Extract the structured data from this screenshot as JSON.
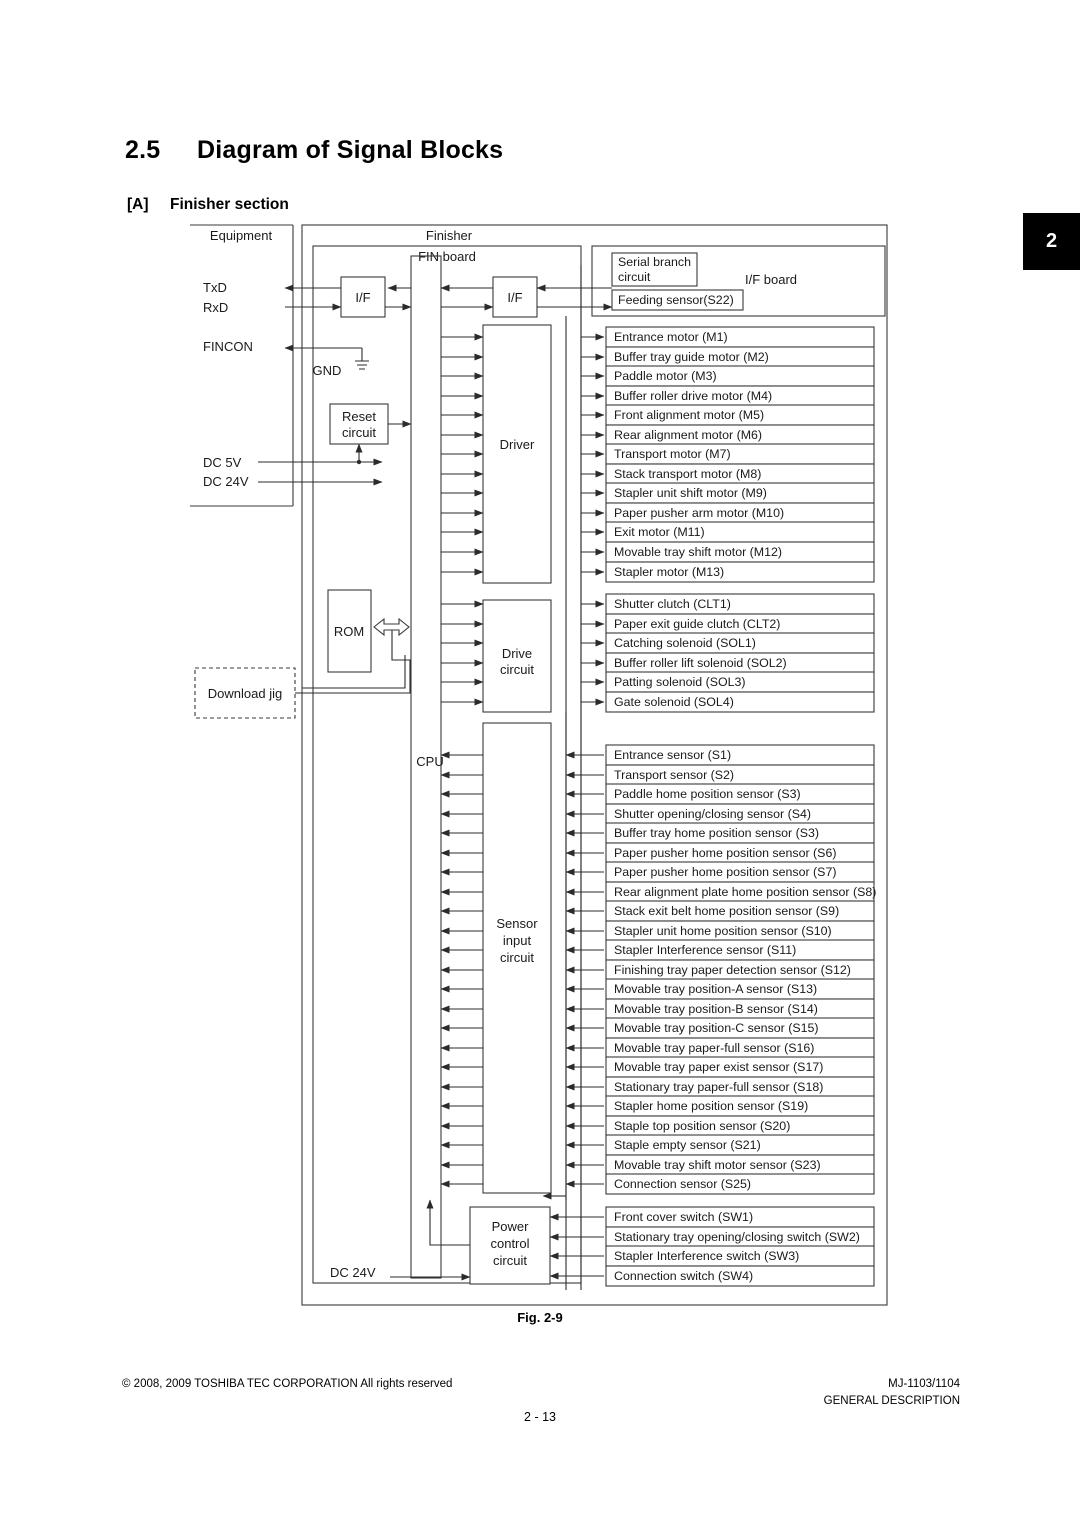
{
  "page": {
    "section_number": "2.5",
    "section_title": "Diagram of Signal Blocks",
    "subsection_tag": "[A]",
    "subsection_title": "Finisher section",
    "chapter_tab": "2",
    "figure_caption": "Fig. 2-9",
    "page_number": "2 - 13"
  },
  "footer": {
    "copyright": "© 2008, 2009 TOSHIBA TEC CORPORATION All rights reserved",
    "model": "MJ-1103/1104",
    "manual_section": "GENERAL DESCRIPTION"
  },
  "diagram": {
    "frames": {
      "equipment": "Equipment",
      "finisher": "Finisher",
      "fin_board": "FIN board",
      "if_board": "I/F board"
    },
    "signals": {
      "txd": "TxD",
      "rxd": "RxD",
      "fincon": "FINCON",
      "gnd": "GND",
      "dc5v": "DC 5V",
      "dc24v": "DC 24V",
      "dc24v_power": "DC 24V"
    },
    "blocks": {
      "if_left": "I/F",
      "if_right": "I/F",
      "reset_circuit": "Reset\ncircuit",
      "reset_circuit_l1": "Reset",
      "reset_circuit_l2": "circuit",
      "rom": "ROM",
      "download_jig": "Download jig",
      "cpu": "CPU",
      "driver": "Driver",
      "drive_circuit_l1": "Drive",
      "drive_circuit_l2": "circuit",
      "sensor_input_l1": "Sensor",
      "sensor_input_l2": "input",
      "sensor_input_l3": "circuit",
      "power_control_l1": "Power",
      "power_control_l2": "control",
      "power_control_l3": "circuit",
      "serial_branch_l1": "Serial branch",
      "serial_branch_l2": "circuit",
      "feeding_sensor": "Feeding sensor(S22)"
    },
    "motors": [
      "Entrance motor (M1)",
      "Buffer tray guide motor (M2)",
      "Paddle motor (M3)",
      "Buffer roller drive motor (M4)",
      "Front alignment motor (M5)",
      "Rear alignment motor (M6)",
      "Transport motor (M7)",
      "Stack transport motor (M8)",
      "Stapler unit shift motor (M9)",
      "Paper pusher arm motor (M10)",
      "Exit motor (M11)",
      "Movable tray shift motor (M12)",
      "Stapler motor (M13)"
    ],
    "clutches_solenoids": [
      "Shutter clutch (CLT1)",
      "Paper exit guide clutch (CLT2)",
      "Catching solenoid (SOL1)",
      "Buffer roller lift solenoid (SOL2)",
      "Patting solenoid (SOL3)",
      "Gate solenoid (SOL4)"
    ],
    "sensors": [
      "Entrance sensor (S1)",
      "Transport sensor (S2)",
      "Paddle home position sensor (S3)",
      "Shutter opening/closing sensor (S4)",
      "Buffer tray home position sensor (S3)",
      "Paper pusher home position sensor (S6)",
      "Paper pusher home position sensor (S7)",
      "Rear alignment plate home position sensor (S8)",
      "Stack exit belt home position sensor (S9)",
      "Stapler unit home position sensor (S10)",
      "Stapler Interference sensor (S11)",
      "Finishing tray paper detection sensor (S12)",
      "Movable tray position-A sensor (S13)",
      "Movable tray position-B sensor (S14)",
      "Movable tray position-C sensor (S15)",
      "Movable tray paper-full sensor (S16)",
      "Movable tray paper exist sensor (S17)",
      "Stationary tray paper-full sensor (S18)",
      "Stapler home position sensor (S19)",
      "Staple top position sensor (S20)",
      "Staple empty sensor (S21)",
      "Movable tray shift motor sensor (S23)",
      "Connection sensor (S25)"
    ],
    "switches": [
      "Front cover switch (SW1)",
      "Stationary tray opening/closing switch (SW2)",
      "Stapler Interference switch (SW3)",
      "Connection switch (SW4)"
    ]
  }
}
